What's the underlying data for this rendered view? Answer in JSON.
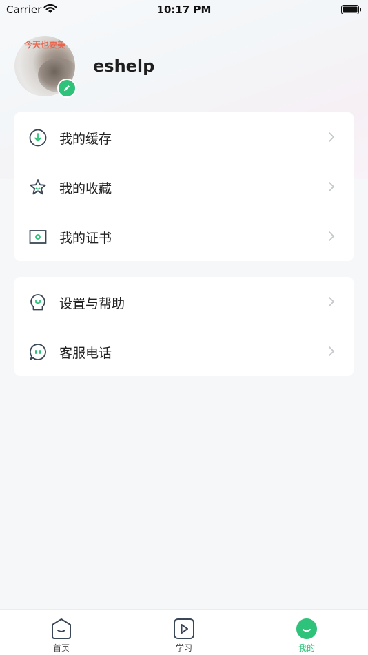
{
  "status_bar": {
    "carrier": "Carrier",
    "time": "10:17 PM"
  },
  "profile": {
    "avatar_text": "今天也要美",
    "username": "eshelp"
  },
  "menu_group_1": [
    {
      "label": "我的缓存",
      "icon": "download-icon"
    },
    {
      "label": "我的收藏",
      "icon": "star-icon"
    },
    {
      "label": "我的证书",
      "icon": "certificate-icon"
    }
  ],
  "menu_group_2": [
    {
      "label": "设置与帮助",
      "icon": "help-bulb-icon"
    },
    {
      "label": "客服电话",
      "icon": "chat-icon"
    }
  ],
  "tab_bar": {
    "tabs": [
      {
        "label": "首页",
        "icon": "home-icon"
      },
      {
        "label": "学习",
        "icon": "play-icon"
      },
      {
        "label": "我的",
        "icon": "profile-icon",
        "active": true
      }
    ]
  },
  "colors": {
    "accent": "#2ec27a",
    "icon_stroke": "#3a4756"
  }
}
